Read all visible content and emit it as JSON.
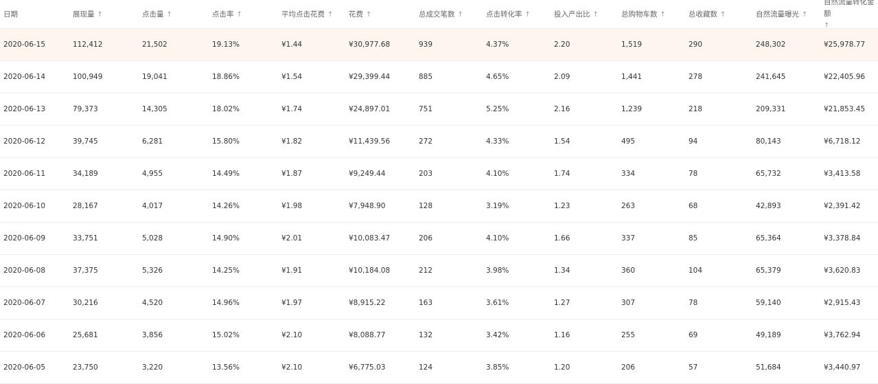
{
  "table": {
    "sort_arrow": "↑",
    "headers": [
      "日期",
      "展现量",
      "点击量",
      "点击率",
      "平均点击花费",
      "花费",
      "总成交笔数",
      "点击转化率",
      "投入产出比",
      "总购物车数",
      "总收藏数",
      "自然流量曝光",
      "自然流量转化金额"
    ],
    "sortable": [
      false,
      true,
      true,
      true,
      true,
      true,
      true,
      true,
      true,
      true,
      true,
      true,
      true
    ],
    "highlight_row": 0,
    "rows": [
      [
        "2020-06-15",
        "112,412",
        "21,502",
        "19.13%",
        "¥1.44",
        "¥30,977.68",
        "939",
        "4.37%",
        "2.20",
        "1,519",
        "290",
        "248,302",
        "¥25,978.77"
      ],
      [
        "2020-06-14",
        "100,949",
        "19,041",
        "18.86%",
        "¥1.54",
        "¥29,399.44",
        "885",
        "4.65%",
        "2.09",
        "1,441",
        "278",
        "241,645",
        "¥22,405.96"
      ],
      [
        "2020-06-13",
        "79,373",
        "14,305",
        "18.02%",
        "¥1.74",
        "¥24,897.01",
        "751",
        "5.25%",
        "2.16",
        "1,239",
        "218",
        "209,331",
        "¥21,853.45"
      ],
      [
        "2020-06-12",
        "39,745",
        "6,281",
        "15.80%",
        "¥1.82",
        "¥11,439.56",
        "272",
        "4.33%",
        "1.54",
        "495",
        "94",
        "80,143",
        "¥6,718.12"
      ],
      [
        "2020-06-11",
        "34,189",
        "4,955",
        "14.49%",
        "¥1.87",
        "¥9,249.44",
        "203",
        "4.10%",
        "1.74",
        "334",
        "78",
        "65,732",
        "¥3,413.58"
      ],
      [
        "2020-06-10",
        "28,167",
        "4,017",
        "14.26%",
        "¥1.98",
        "¥7,948.90",
        "128",
        "3.19%",
        "1.23",
        "263",
        "68",
        "42,893",
        "¥2,391.42"
      ],
      [
        "2020-06-09",
        "33,751",
        "5,028",
        "14.90%",
        "¥2.01",
        "¥10,083.47",
        "206",
        "4.10%",
        "1.66",
        "337",
        "85",
        "65,364",
        "¥3,378.84"
      ],
      [
        "2020-06-08",
        "37,375",
        "5,326",
        "14.25%",
        "¥1.91",
        "¥10,184.08",
        "212",
        "3.98%",
        "1.34",
        "360",
        "104",
        "65,379",
        "¥3,620.83"
      ],
      [
        "2020-06-07",
        "30,216",
        "4,520",
        "14.96%",
        "¥1.97",
        "¥8,915.22",
        "163",
        "3.61%",
        "1.27",
        "307",
        "78",
        "59,140",
        "¥2,915.43"
      ],
      [
        "2020-06-06",
        "25,681",
        "3,856",
        "15.02%",
        "¥2.10",
        "¥8,088.77",
        "132",
        "3.42%",
        "1.16",
        "255",
        "69",
        "49,189",
        "¥3,762.94"
      ],
      [
        "2020-06-05",
        "23,750",
        "3,220",
        "13.56%",
        "¥2.10",
        "¥6,775.03",
        "124",
        "3.85%",
        "1.20",
        "206",
        "57",
        "51,684",
        "¥3,440.97"
      ]
    ]
  },
  "colors": {
    "highlight_row_bg": "#fdf5ee",
    "header_text": "#666666",
    "body_text": "#333333",
    "divider": "#ececec"
  }
}
